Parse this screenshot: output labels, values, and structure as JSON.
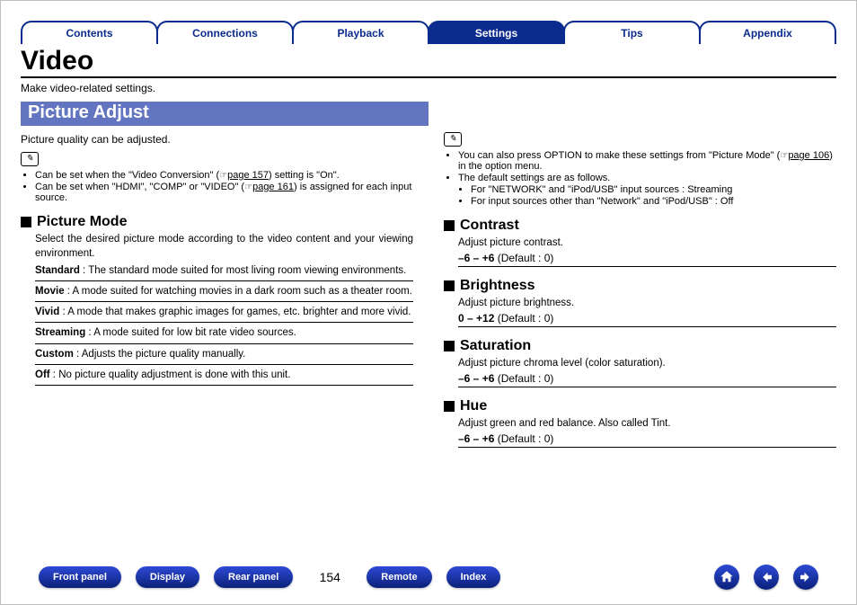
{
  "tabs": [
    {
      "label": "Contents",
      "active": false
    },
    {
      "label": "Connections",
      "active": false
    },
    {
      "label": "Playback",
      "active": false
    },
    {
      "label": "Settings",
      "active": true
    },
    {
      "label": "Tips",
      "active": false
    },
    {
      "label": "Appendix",
      "active": false
    }
  ],
  "title": "Video",
  "intro": "Make video-related settings.",
  "subheading": "Picture Adjust",
  "lead_text": "Picture quality can be adjusted.",
  "note_left": {
    "bullet1_pre": "Can be set when the \"Video Conversion\" (",
    "bullet1_ref": "page 157",
    "bullet1_post": ") setting is \"On\".",
    "bullet2_pre": "Can be set when \"HDMI\", \"COMP\" or \"VIDEO\" (",
    "bullet2_ref": "page 161",
    "bullet2_post": ") is assigned for each input source."
  },
  "picture_mode": {
    "heading": "Picture Mode",
    "desc": "Select the desired picture mode according to the video content and your viewing environment.",
    "rows": [
      {
        "term": "Standard",
        "colon": " : ",
        "text": "The standard mode suited for most living room viewing environments."
      },
      {
        "term": "Movie",
        "colon": " : ",
        "text": "A mode suited for watching movies in a dark room such as a theater room."
      },
      {
        "term": "Vivid",
        "colon": " : ",
        "text": "A mode that makes graphic images for games, etc. brighter and more vivid."
      },
      {
        "term": "Streaming",
        "colon": " : ",
        "text": "A mode suited for low bit rate video sources."
      },
      {
        "term": "Custom",
        "colon": " : ",
        "text": "Adjusts the picture quality manually."
      },
      {
        "term": "Off",
        "colon": " : ",
        "text": "No picture quality adjustment is done with this unit."
      }
    ]
  },
  "note_right": {
    "bullet1_pre": "You can also press OPTION to make these settings from \"Picture Mode\" (",
    "bullet1_ref": "page 106",
    "bullet1_post": ") in the option menu.",
    "bullet2": "The default settings are as follows.",
    "bullet2a": "For \"NETWORK\" and \"iPod/USB\" input sources : Streaming",
    "bullet2b": "For input sources other than \"Network\" and \"iPod/USB\" : Off"
  },
  "settings_right": [
    {
      "heading": "Contrast",
      "desc": "Adjust picture contrast.",
      "range": "–6 – +6",
      "default": " (Default : 0)"
    },
    {
      "heading": "Brightness",
      "desc": "Adjust picture brightness.",
      "range": "0 – +12",
      "default": " (Default : 0)"
    },
    {
      "heading": "Saturation",
      "desc": "Adjust picture chroma level (color saturation).",
      "range": "–6 – +6",
      "default": " (Default : 0)"
    },
    {
      "heading": "Hue",
      "desc": "Adjust green and red balance. Also called Tint.",
      "range": "–6 – +6",
      "default": " (Default : 0)"
    }
  ],
  "footer": {
    "pills_left": [
      "Front panel",
      "Display",
      "Rear panel"
    ],
    "page_number": "154",
    "pills_right": [
      "Remote",
      "Index"
    ],
    "icons": [
      "home-icon",
      "back-icon",
      "forward-icon"
    ]
  }
}
